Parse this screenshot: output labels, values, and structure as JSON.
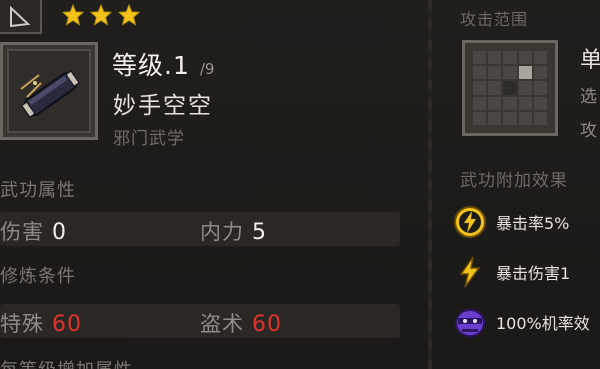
{
  "colors": {
    "accent_star": "#f2c21a",
    "value_red": "#e0322b",
    "effect_purple": "#6a3fd0"
  },
  "header": {
    "stars": 3
  },
  "skill": {
    "level_label": "等级.1",
    "level_max": "/9",
    "name": "妙手空空",
    "type": "邪门武学",
    "icon": "scroll-icon"
  },
  "attributes": {
    "section_label": "武功属性",
    "items": [
      {
        "label": "伤害",
        "value": "0"
      },
      {
        "label": "内力",
        "value": "5"
      }
    ]
  },
  "requirements": {
    "section_label": "修炼条件",
    "items": [
      {
        "label": "特殊",
        "value": "60"
      },
      {
        "label": "盗术",
        "value": "60"
      }
    ]
  },
  "bottom_section": {
    "label": "每等级增加属性"
  },
  "attack_range": {
    "label": "攻击范围",
    "side_texts": [
      "单",
      "选",
      "攻"
    ]
  },
  "effects": {
    "label": "武功附加效果",
    "items": [
      {
        "icon": "lightning-badge-icon",
        "text": "暴击率5%"
      },
      {
        "icon": "lightning-icon",
        "text": "暴击伤害1"
      },
      {
        "icon": "thief-mask-icon",
        "text": "100%机率效"
      }
    ]
  }
}
